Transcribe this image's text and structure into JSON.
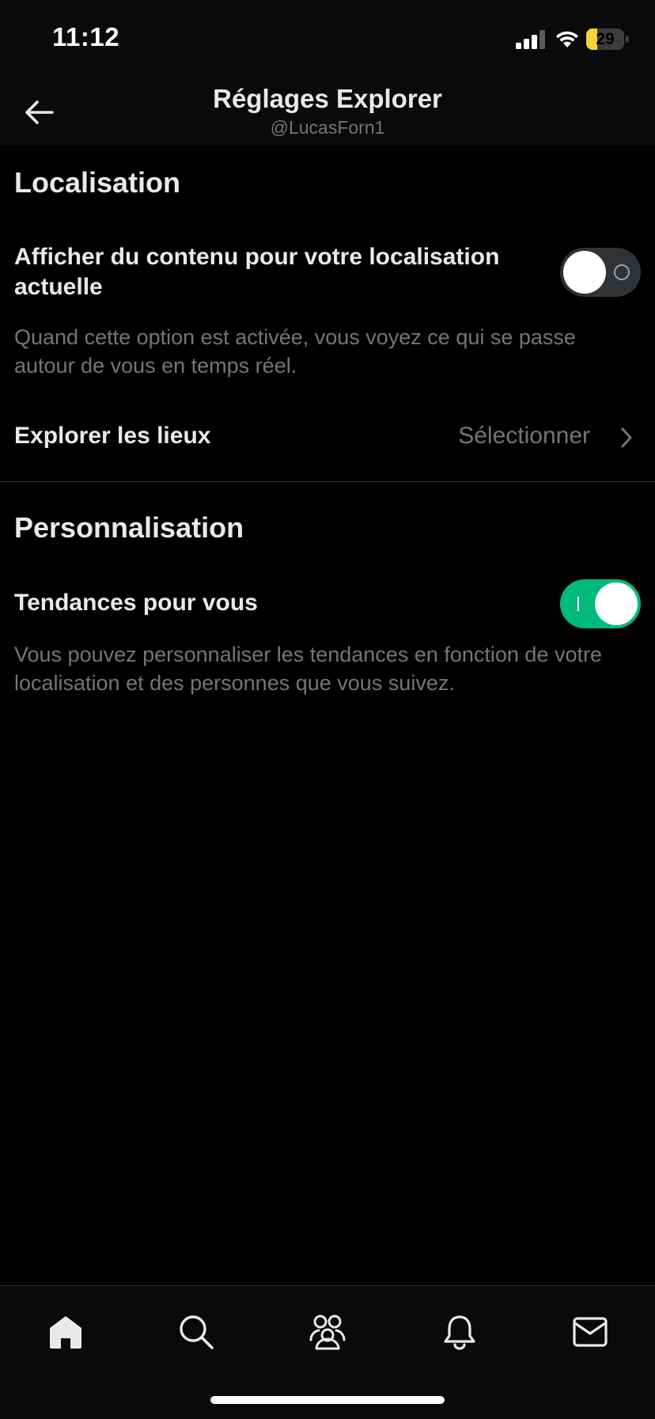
{
  "status_bar": {
    "time": "11:12",
    "battery_level": "29",
    "battery_fraction": 0.29,
    "battery_color": "#f7d435",
    "icons": [
      "signal-icon",
      "wifi-icon",
      "battery-icon"
    ]
  },
  "header": {
    "back_icon": "arrow-left-icon",
    "title": "Réglages Explorer",
    "subtitle": "@LucasForn1"
  },
  "location_section": {
    "title": "Localisation",
    "current_location": {
      "label": "Afficher du contenu pour votre localisation actuelle",
      "enabled": false,
      "description": "Quand cette option est activée, vous voyez ce qui se passe autour de vous en temps réel."
    },
    "explore_places": {
      "label": "Explorer les lieux",
      "value": "Sélectionner",
      "icon": "chevron-right-icon"
    }
  },
  "personalization_section": {
    "title": "Personnalisation",
    "trends_for_you": {
      "label": "Tendances pour vous",
      "enabled": true,
      "description": "Vous pouvez personnaliser les tendances en fonction de votre localisation et des personnes que vous suivez."
    }
  },
  "bottom_nav": {
    "tabs": [
      "home-icon",
      "search-icon",
      "communities-icon",
      "notifications-bell-icon",
      "messages-mail-icon"
    ],
    "active": "home-icon"
  },
  "colors": {
    "background": "#000000",
    "primary_text": "#e7e9ea",
    "secondary_text": "#71767b",
    "toggle_on": "#00ba7c",
    "toggle_off": "#2f3336"
  }
}
